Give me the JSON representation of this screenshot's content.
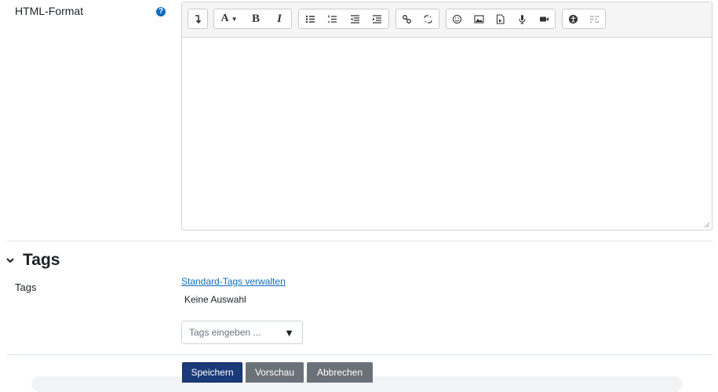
{
  "format_field": {
    "label": "HTML-Format",
    "help_icon": "question-circle-icon",
    "toolbar": {
      "groups": [
        [
          {
            "name": "collapse-toolbar",
            "glyph": "↴"
          }
        ],
        [
          {
            "name": "paragraph-style",
            "glyph": "A▾"
          },
          {
            "name": "bold",
            "glyph": "B"
          },
          {
            "name": "italic",
            "glyph": "I"
          }
        ],
        [
          {
            "name": "unordered-list",
            "glyph": "≔"
          },
          {
            "name": "ordered-list",
            "glyph": "⁝"
          },
          {
            "name": "outdent",
            "glyph": "⇤"
          },
          {
            "name": "indent",
            "glyph": "⇥"
          }
        ],
        [
          {
            "name": "link",
            "glyph": "∞"
          },
          {
            "name": "unlink",
            "glyph": "⤫"
          }
        ],
        [
          {
            "name": "emoji",
            "glyph": "☺"
          },
          {
            "name": "image",
            "glyph": "▣"
          },
          {
            "name": "media",
            "glyph": "▤"
          },
          {
            "name": "record-audio",
            "glyph": "🎤"
          },
          {
            "name": "record-video",
            "glyph": "■"
          }
        ],
        [
          {
            "name": "accessibility-checker",
            "glyph": "◉"
          },
          {
            "name": "screenreader-helper",
            "glyph": "⠿"
          }
        ]
      ]
    }
  },
  "tags_section": {
    "title": "Tags",
    "field_label": "Tags",
    "manage_link": "Standard-Tags verwalten",
    "no_selection": "Keine Auswahl",
    "input_placeholder": "Tags eingeben ...",
    "arrow_glyph": "▼"
  },
  "buttons": {
    "save": "Speichern",
    "preview": "Vorschau",
    "cancel": "Abbrechen"
  }
}
